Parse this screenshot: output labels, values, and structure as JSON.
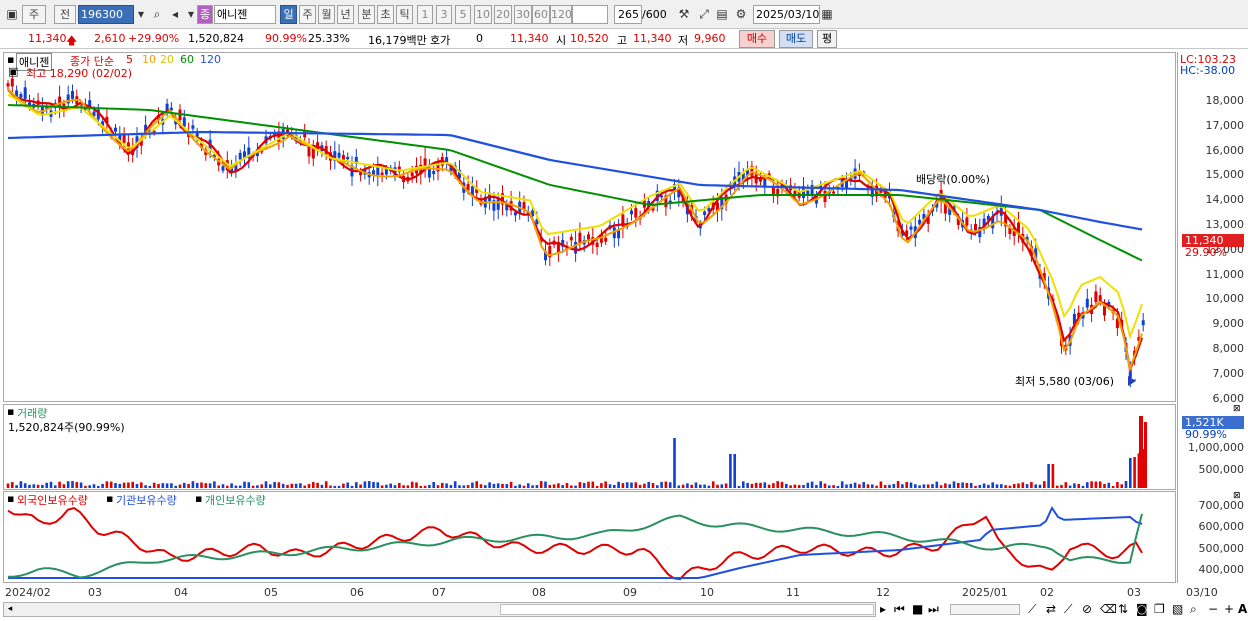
{
  "toolbar": {
    "type_label": "주",
    "prev_label": "전",
    "stock_code": "196300",
    "stock_name": "애니젠",
    "badge": "종",
    "periods": [
      "일",
      "주",
      "월",
      "년",
      "분",
      "초",
      "틱"
    ],
    "minutes": [
      "1",
      "3",
      "5",
      "10",
      "20",
      "30",
      "60",
      "120"
    ],
    "count": "265",
    "max_count": "/600",
    "date": "2025/03/10"
  },
  "quote": {
    "price": "11,340",
    "change": "2,610",
    "change_pct": "+29.90%",
    "volume": "1,520,824",
    "vol_ratio": "90.99%",
    "turnover": "25.33%",
    "amount": "16,179백만",
    "hoga_label": "호가",
    "hoga_value": "0",
    "hoga_price": "11,340",
    "open_label": "시",
    "open": "10,520",
    "high_label": "고",
    "high": "11,340",
    "low_label": "저",
    "low": "9,960",
    "buy_label": "매수",
    "sell_label": "매도",
    "eval_label": "평"
  },
  "price_panel": {
    "stock_label": "애니젠",
    "ma_label": "종가 단순",
    "ma_periods": [
      "5",
      "10",
      "20",
      "60",
      "120"
    ],
    "ma_colors": [
      "#e00000",
      "#f0a000",
      "#f0e000",
      "#009000",
      "#2050e0"
    ],
    "high_annotation": "최고 18,290 (02/02)",
    "low_annotation": "최저 5,580 (03/06)",
    "dividend_annotation": "배당락(0.00%)",
    "lc": "LC:103.23",
    "hc": "HC:-38.00",
    "last_price_tag": "11,340",
    "last_pct_tag": "29.90%",
    "y_ticks": [
      "18,000",
      "17,000",
      "16,000",
      "15,000",
      "14,000",
      "13,000",
      "12,000",
      "11,000",
      "10,000",
      "9,000",
      "8,000",
      "7,000",
      "6,000"
    ]
  },
  "volume_panel": {
    "label": "거래량",
    "value": "1,520,824주(90.99%)",
    "tag_value": "1,521K",
    "tag_pct": "90.99%",
    "y_ticks": [
      "1,500,000",
      "1,000,000",
      "500,000"
    ]
  },
  "holder_panel": {
    "labels": [
      "외국인보유수량",
      "기관보유수량",
      "개인보유수량"
    ],
    "colors": [
      "#e00000",
      "#2050e0",
      "#2a9060"
    ],
    "y_ticks": [
      "700,000",
      "600,000",
      "500,000",
      "400,000"
    ]
  },
  "x_labels": [
    "2024/02",
    "03",
    "04",
    "05",
    "06",
    "07",
    "08",
    "09",
    "10",
    "11",
    "12",
    "2025/01",
    "02",
    "03",
    "03/10"
  ]
}
